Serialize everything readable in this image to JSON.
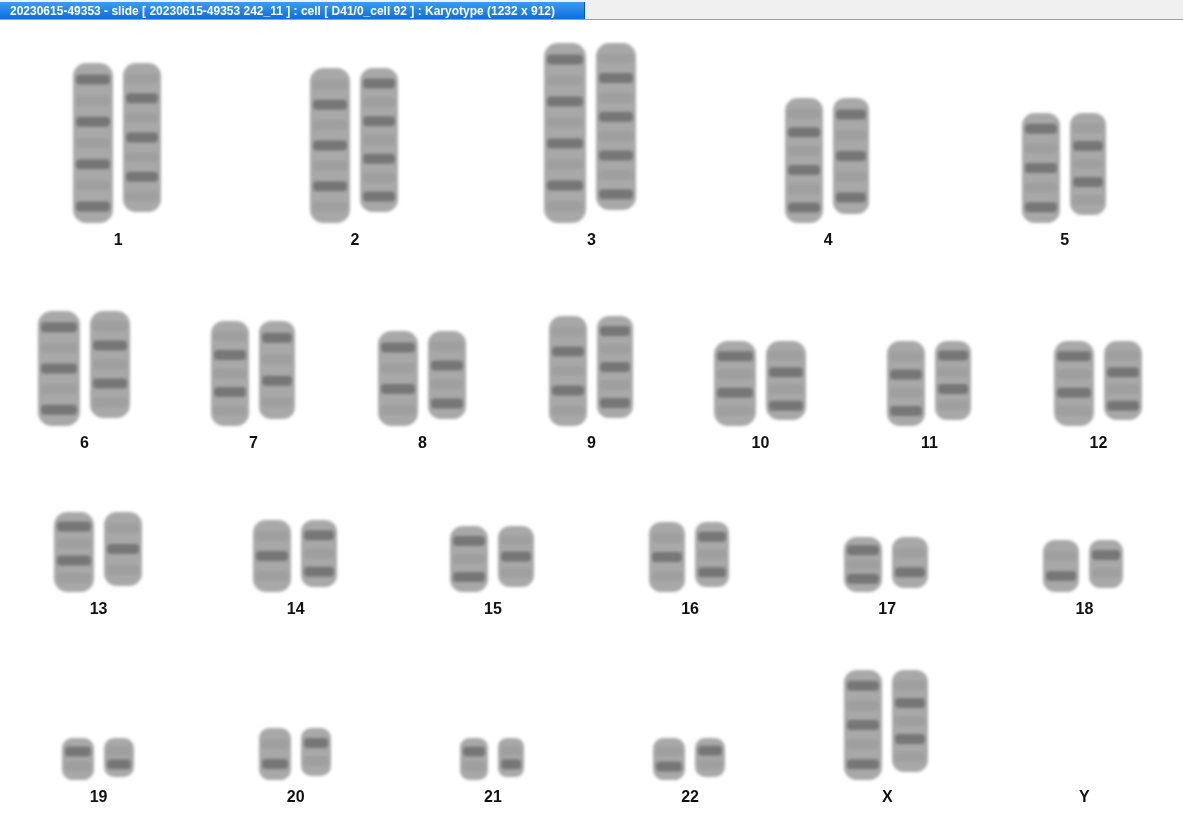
{
  "window": {
    "title": "20230615-49353 - slide [ 20230615-49353 242_11 ] : cell [ D41/0_cell 92 ] : Karyotype  (1232 x 912)"
  },
  "karyotype": {
    "rows": [
      {
        "pairs": [
          {
            "label": "1",
            "present": true
          },
          {
            "label": "2",
            "present": true
          },
          {
            "label": "3",
            "present": true
          },
          {
            "label": "4",
            "present": true
          },
          {
            "label": "5",
            "present": true
          }
        ]
      },
      {
        "pairs": [
          {
            "label": "6",
            "present": true
          },
          {
            "label": "7",
            "present": true
          },
          {
            "label": "8",
            "present": true
          },
          {
            "label": "9",
            "present": true
          },
          {
            "label": "10",
            "present": true
          },
          {
            "label": "11",
            "present": true
          },
          {
            "label": "12",
            "present": true
          }
        ]
      },
      {
        "pairs": [
          {
            "label": "13",
            "present": true
          },
          {
            "label": "14",
            "present": true
          },
          {
            "label": "15",
            "present": true
          },
          {
            "label": "16",
            "present": true
          },
          {
            "label": "17",
            "present": true
          },
          {
            "label": "18",
            "present": true
          }
        ]
      },
      {
        "pairs": [
          {
            "label": "19",
            "present": true
          },
          {
            "label": "20",
            "present": true
          },
          {
            "label": "21",
            "present": true
          },
          {
            "label": "22",
            "present": true
          },
          {
            "label": "X",
            "present": true
          },
          {
            "label": "Y",
            "present": false
          }
        ]
      }
    ]
  }
}
